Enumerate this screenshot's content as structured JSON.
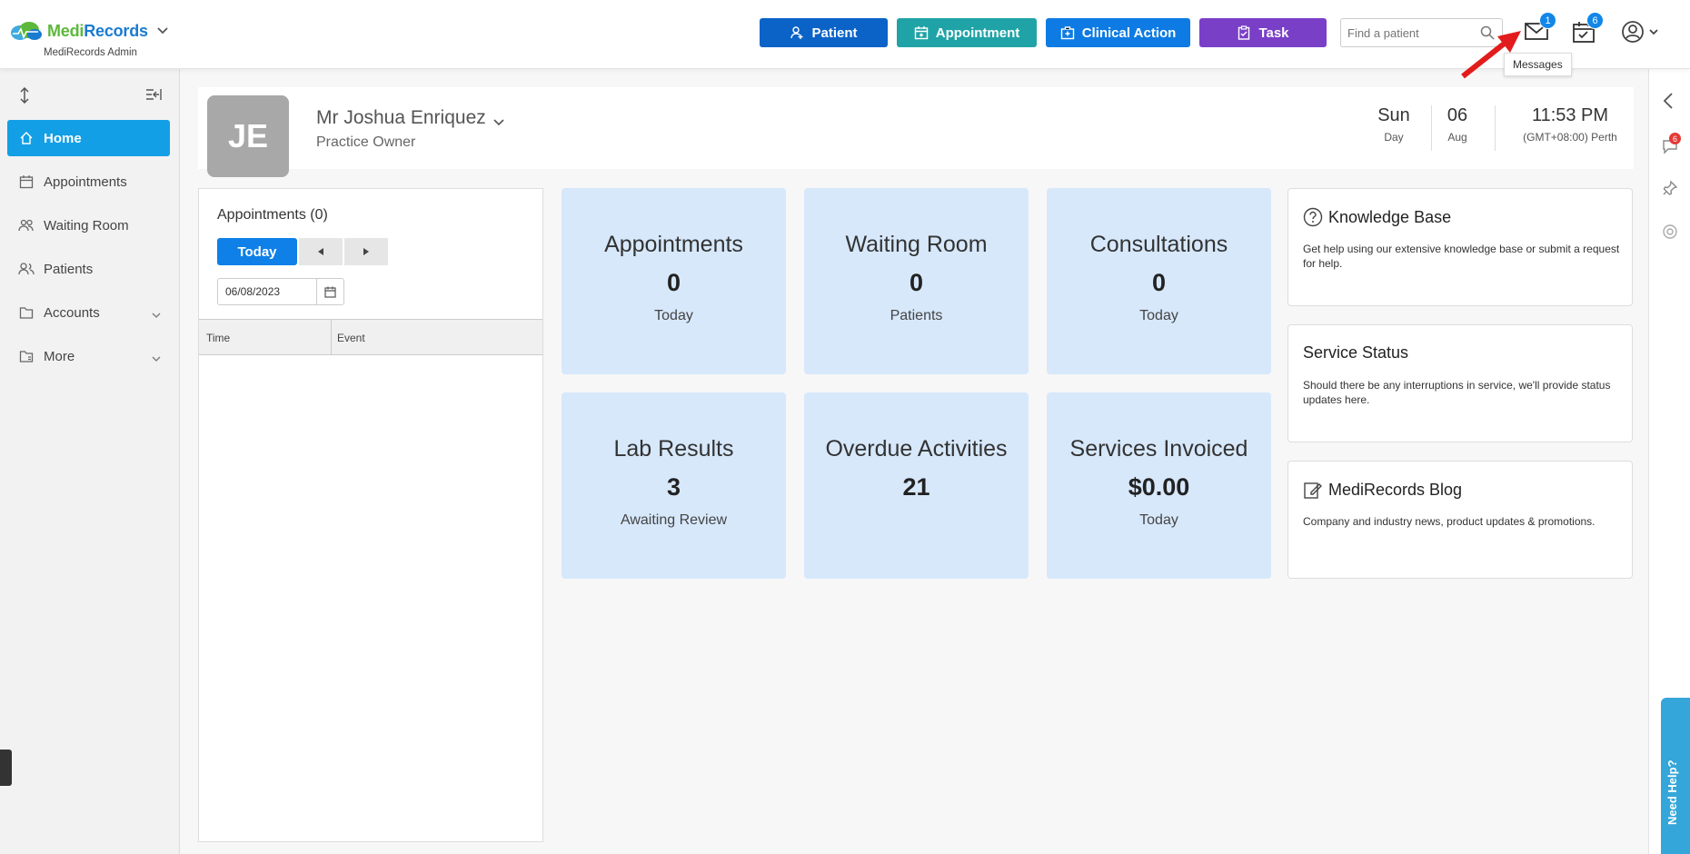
{
  "brand": {
    "name_a": "Medi",
    "name_b": "Records",
    "subtitle": "MediRecords Admin"
  },
  "quick_actions": {
    "patient": "Patient",
    "appointment": "Appointment",
    "clinical_action": "Clinical Action",
    "task": "Task"
  },
  "search": {
    "placeholder": "Find a patient"
  },
  "header": {
    "messages_badge": "1",
    "tasks_badge": "6",
    "tooltip": "Messages"
  },
  "sidebar": {
    "items": [
      {
        "label": "Home"
      },
      {
        "label": "Appointments"
      },
      {
        "label": "Waiting Room"
      },
      {
        "label": "Patients"
      },
      {
        "label": "Accounts"
      },
      {
        "label": "More"
      }
    ]
  },
  "profile": {
    "initials": "JE",
    "name": "Mr Joshua Enriquez",
    "role": "Practice Owner",
    "day": "Sun",
    "day_label": "Day",
    "date": "06",
    "month": "Aug",
    "time": "11:53 PM",
    "timezone": "(GMT+08:00) Perth"
  },
  "appointments_panel": {
    "title": "Appointments (0)",
    "today_btn": "Today",
    "date": "06/08/2023",
    "columns": [
      "Time",
      "Event"
    ]
  },
  "tiles": [
    {
      "title": "Appointments",
      "value": "0",
      "sub": "Today"
    },
    {
      "title": "Waiting Room",
      "value": "0",
      "sub": "Patients"
    },
    {
      "title": "Consultations",
      "value": "0",
      "sub": "Today"
    },
    {
      "title": "Lab Results",
      "value": "3",
      "sub": "Awaiting Review"
    },
    {
      "title": "Overdue Activities",
      "value": "21",
      "sub": ""
    },
    {
      "title": "Services Invoiced",
      "value": "$0.00",
      "sub": "Today"
    }
  ],
  "cards": [
    {
      "title": "Knowledge Base",
      "text": "Get help using our extensive knowledge base or submit a request for help."
    },
    {
      "title": "Service Status",
      "text": "Should there be any interruptions in service, we'll provide status updates here."
    },
    {
      "title": "MediRecords Blog",
      "text": "Company and industry news, product updates & promotions."
    }
  ],
  "rail": {
    "chat_badge": "6",
    "need_help": "Need Help?"
  },
  "colors": {
    "primary": "#0b63c8",
    "teal": "#20a3a7",
    "purple": "#7a3fc7",
    "active_nav": "#139fe6",
    "tile_bg": "#d7e8fb"
  }
}
